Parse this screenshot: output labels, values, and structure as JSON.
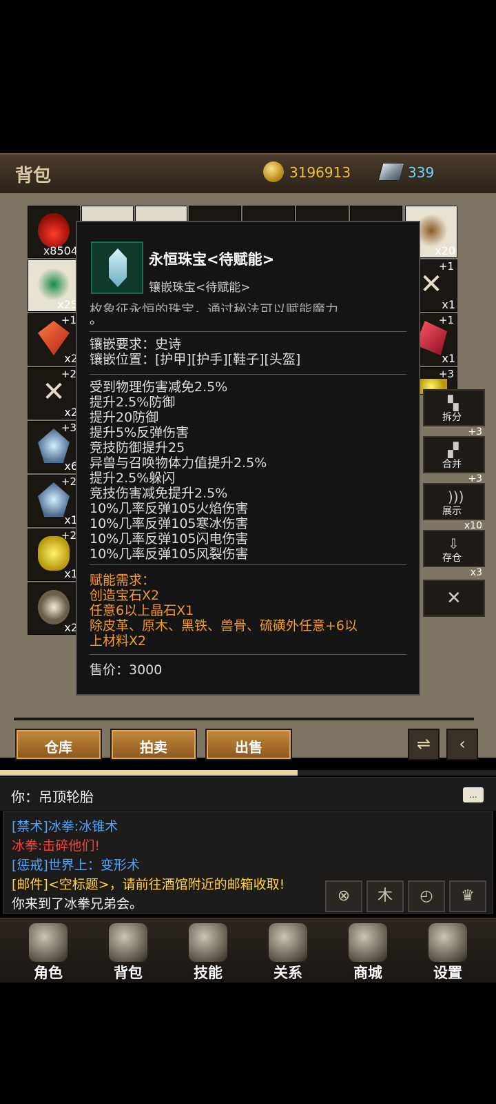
{
  "header": {
    "title": "背包",
    "gold": "3196913",
    "gems": "339",
    "gold_icon": "gold-coin-icon",
    "gem_icon": "iron-ingot-icon"
  },
  "inventory": {
    "slots": [
      {
        "count": "x8504",
        "plus": ""
      },
      {
        "count": "x25",
        "plus": ""
      },
      {
        "count": "x2",
        "plus": "+1"
      },
      {
        "count": "x2",
        "plus": "+2"
      },
      {
        "count": "x6",
        "plus": "+3"
      },
      {
        "count": "x1",
        "plus": "+2"
      },
      {
        "count": "x1",
        "plus": "+2"
      },
      {
        "count": "x2",
        "plus": ""
      }
    ],
    "right_slots": [
      {
        "count": "x20",
        "plus": ""
      },
      {
        "count": "x1",
        "plus": "+1"
      },
      {
        "count": "x1",
        "plus": "+1"
      },
      {
        "count": "",
        "plus": "+3"
      }
    ],
    "partial_right": [
      "+3",
      "+3",
      "x10",
      "x3"
    ]
  },
  "side_buttons": [
    {
      "label": "拆分",
      "icon": "split-icon"
    },
    {
      "label": "合并",
      "icon": "merge-icon"
    },
    {
      "label": "展示",
      "icon": "broadcast-icon"
    },
    {
      "label": "存仓",
      "icon": "store-icon"
    },
    {
      "label": "",
      "icon": "close-icon"
    }
  ],
  "tooltip": {
    "name": "永恒珠宝<待赋能>",
    "type": "镶嵌珠宝<待赋能>",
    "desc_1": "枚象征永恒的珠宝，通过秘法可以赋能魔力",
    "desc_2": "。",
    "req": "镶嵌要求：史诗",
    "slots": "镶嵌位置：[护甲][护手][鞋子][头盔]",
    "stats": [
      "受到物理伤害减免2.5%",
      "提升2.5%防御",
      "提升20防御",
      "提升5%反弹伤害",
      "竞技防御提升25",
      "异兽与召唤物体力值提升2.5%",
      "提升2.5%躲闪",
      "竞技伤害减免提升2.5%",
      "10%几率反弹105火焰伤害",
      "10%几率反弹105寒冰伤害",
      "10%几率反弹105闪电伤害",
      "10%几率反弹105风裂伤害"
    ],
    "empower": [
      "赋能需求：",
      "创造宝石X2",
      "任意6以上晶石X1",
      "除皮革、原木、黑铁、兽骨、硫磺外任意+6以",
      "上材料X2"
    ],
    "price": "售价：3000"
  },
  "actions": {
    "warehouse": "仓库",
    "auction": "拍卖",
    "sell": "出售",
    "sort_icon": "sort-icon",
    "back_icon": "back-arrow-icon"
  },
  "progress": 0.6,
  "chat": {
    "self_line": "你：吊顶轮胎",
    "bubble": "...",
    "lines": [
      {
        "text": "[禁术]冰拳:冰锥术",
        "color": "#4aa3ff"
      },
      {
        "text": "冰拳:击碎他们!",
        "color": "#ff3b30"
      },
      {
        "text": "[惩戒]世界上：变形术",
        "color": "#4aa3ff"
      },
      {
        "text": "[邮件]<空标题>，请前往酒馆附近的邮箱收取!",
        "color": "#ffd23f"
      },
      {
        "text": "你来到了冰拳兄弟会。",
        "color": "#f0f0f0"
      }
    ],
    "buttons": [
      "crosshair-icon",
      "wood-icon",
      "clock-icon",
      "trophy-icon"
    ]
  },
  "nav": [
    {
      "label": "角色",
      "icon": "helmet-icon"
    },
    {
      "label": "背包",
      "icon": "backpack-icon"
    },
    {
      "label": "技能",
      "icon": "skill-book-icon"
    },
    {
      "label": "关系",
      "icon": "gauntlets-icon"
    },
    {
      "label": "商城",
      "icon": "chest-icon"
    },
    {
      "label": "设置",
      "icon": "gear-icon"
    }
  ]
}
